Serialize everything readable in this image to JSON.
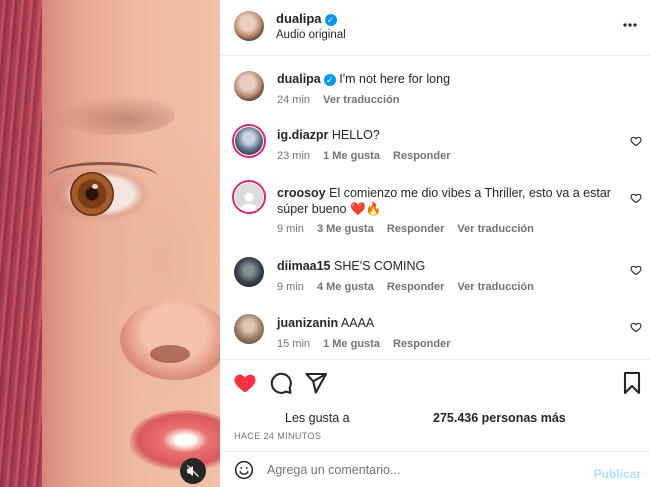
{
  "header": {
    "username": "dualipa",
    "subtitle": "Audio original",
    "more_icon": "more-horizontal-icon"
  },
  "caption": {
    "username": "dualipa",
    "text": "I'm not here for long",
    "time": "24 min",
    "translate": "Ver traducción"
  },
  "comments": [
    {
      "username": "ig.diazpr",
      "text": "HELLO?",
      "time": "23 min",
      "likes": "1 Me gusta",
      "reply": "Responder",
      "translate": ""
    },
    {
      "username": "croosoy",
      "text": "El comienzo me dio vibes a Thriller, esto va a estar súper bueno",
      "emoji": "❤️🔥",
      "time": "9 min",
      "likes": "3 Me gusta",
      "reply": "Responder",
      "translate": "Ver traducción"
    },
    {
      "username": "diimaa15",
      "text": "SHE'S COMING",
      "time": "9 min",
      "likes": "4 Me gusta",
      "reply": "Responder",
      "translate": "Ver traducción"
    },
    {
      "username": "juanizanin",
      "text": "AAAA",
      "time": "15 min",
      "likes": "1 Me gusta",
      "reply": "Responder",
      "translate": ""
    }
  ],
  "likes": {
    "label": "Les gusta a",
    "count": "275.436 personas más"
  },
  "time_ago": "HACE 24 MINUTOS",
  "composer": {
    "placeholder": "Agrega un comentario...",
    "publish": "Publicar"
  },
  "colors": {
    "liked": "#ff3040",
    "verified": "#0095f6",
    "publish_disabled": "#b2dffc"
  }
}
